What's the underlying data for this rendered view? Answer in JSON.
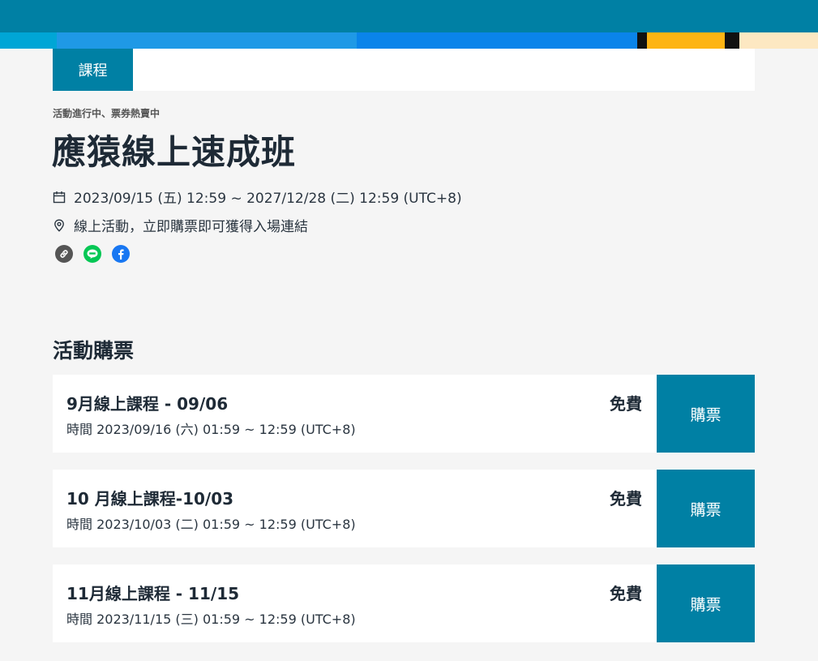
{
  "tabs": {
    "active_label": "課程"
  },
  "event": {
    "status": "活動進行中、票券熱賣中",
    "title": "應猿線上速成班",
    "date_range": "2023/09/15 (五) 12:59 ~ 2027/12/28 (二) 12:59 (UTC+8)",
    "location": "線上活動，立即購票即可獲得入場連結"
  },
  "share": {
    "icons": [
      "link-icon",
      "line-icon",
      "facebook-icon"
    ]
  },
  "tickets_section": {
    "title": "活動購票",
    "items": [
      {
        "name": "9月線上課程 - 09/06",
        "time": "時間  2023/09/16 (六) 01:59 ~ 12:59 (UTC+8)",
        "price": "免費",
        "buy_label": "購票"
      },
      {
        "name": "10 月線上課程-10/03",
        "time": "時間  2023/10/03 (二) 01:59 ~ 12:59 (UTC+8)",
        "price": "免費",
        "buy_label": "購票"
      },
      {
        "name": "11月線上課程 - 11/15",
        "time": "時間  2023/11/15 (三) 01:59 ~ 12:59 (UTC+8)",
        "price": "免費",
        "buy_label": "購票"
      }
    ]
  },
  "colors": {
    "accent": "#0080a4",
    "background": "#f5f5f5",
    "line_green": "#06c755",
    "facebook_blue": "#1877f2"
  }
}
